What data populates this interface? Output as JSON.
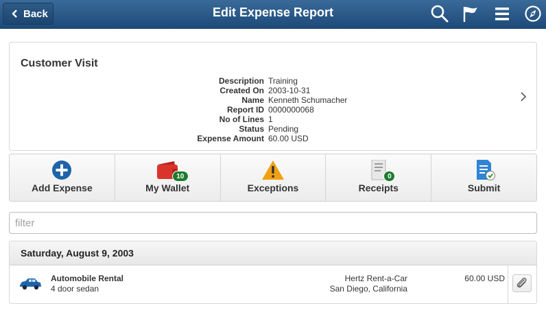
{
  "header": {
    "back_label": "Back",
    "title": "Edit Expense Report",
    "icons": [
      "search-icon",
      "flag-icon",
      "menu-icon",
      "navigation-icon"
    ]
  },
  "report": {
    "name": "Customer Visit",
    "fields": [
      {
        "label": "Description",
        "value": "Training"
      },
      {
        "label": "Created On",
        "value": "2003-10-31"
      },
      {
        "label": "Name",
        "value": "Kenneth Schumacher"
      },
      {
        "label": "Report ID",
        "value": "0000000068"
      },
      {
        "label": "No of Lines",
        "value": "1"
      },
      {
        "label": "Status",
        "value": "Pending"
      },
      {
        "label": "Expense Amount",
        "value": "60.00 USD"
      }
    ]
  },
  "actions": {
    "add_expense": {
      "label": "Add Expense",
      "icon": "plus-circle-icon"
    },
    "my_wallet": {
      "label": "My Wallet",
      "icon": "wallet-icon",
      "badge": "10"
    },
    "exceptions": {
      "label": "Exceptions",
      "icon": "warning-icon"
    },
    "receipts": {
      "label": "Receipts",
      "icon": "receipt-icon",
      "badge": "0"
    },
    "submit": {
      "label": "Submit",
      "icon": "submit-document-icon"
    }
  },
  "filter": {
    "placeholder": "filter",
    "value": ""
  },
  "groups": [
    {
      "date": "Saturday, August 9, 2003",
      "lines": [
        {
          "type": "Automobile Rental",
          "description": "4 door sedan",
          "merchant": "Hertz Rent-a-Car",
          "location": "San Diego, California",
          "amount": "60.00 USD",
          "icon": "car-icon"
        }
      ]
    }
  ],
  "colors": {
    "header_bg": "#1d4a78",
    "add_icon": "#1f64a8",
    "wallet_icon": "#d9342b",
    "warning_icon": "#f0a112",
    "badge": "#1e7b2f"
  }
}
